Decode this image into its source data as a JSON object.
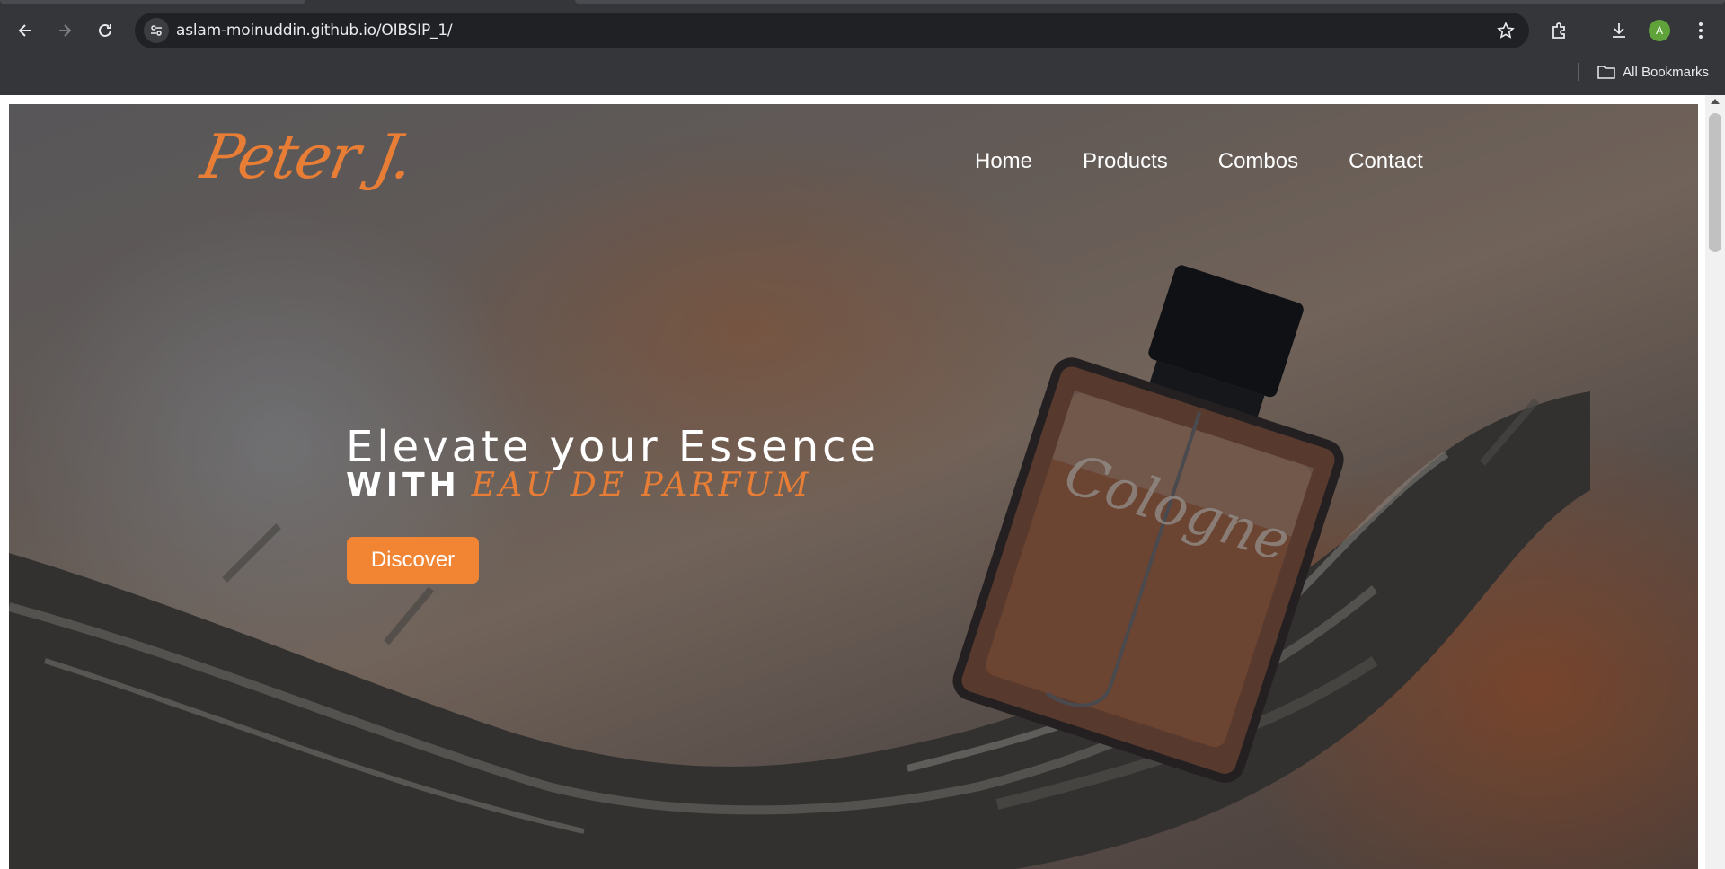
{
  "browser": {
    "url": "aslam-moinuddin.github.io/OIBSIP_1/",
    "profile_initial": "A",
    "bookmarks_label": "All Bookmarks"
  },
  "site": {
    "logo": "Peter J.",
    "nav": [
      "Home",
      "Products",
      "Combos",
      "Contact"
    ],
    "headline_line1": "Elevate your Essence",
    "headline_with": "WITH",
    "headline_accent": "EAU DE PARFUM",
    "cta_label": "Discover",
    "bottle_label": "Cologne"
  },
  "colors": {
    "accent": "#f28534",
    "chrome_bg": "#35363a",
    "omnibox_bg": "#202124"
  }
}
